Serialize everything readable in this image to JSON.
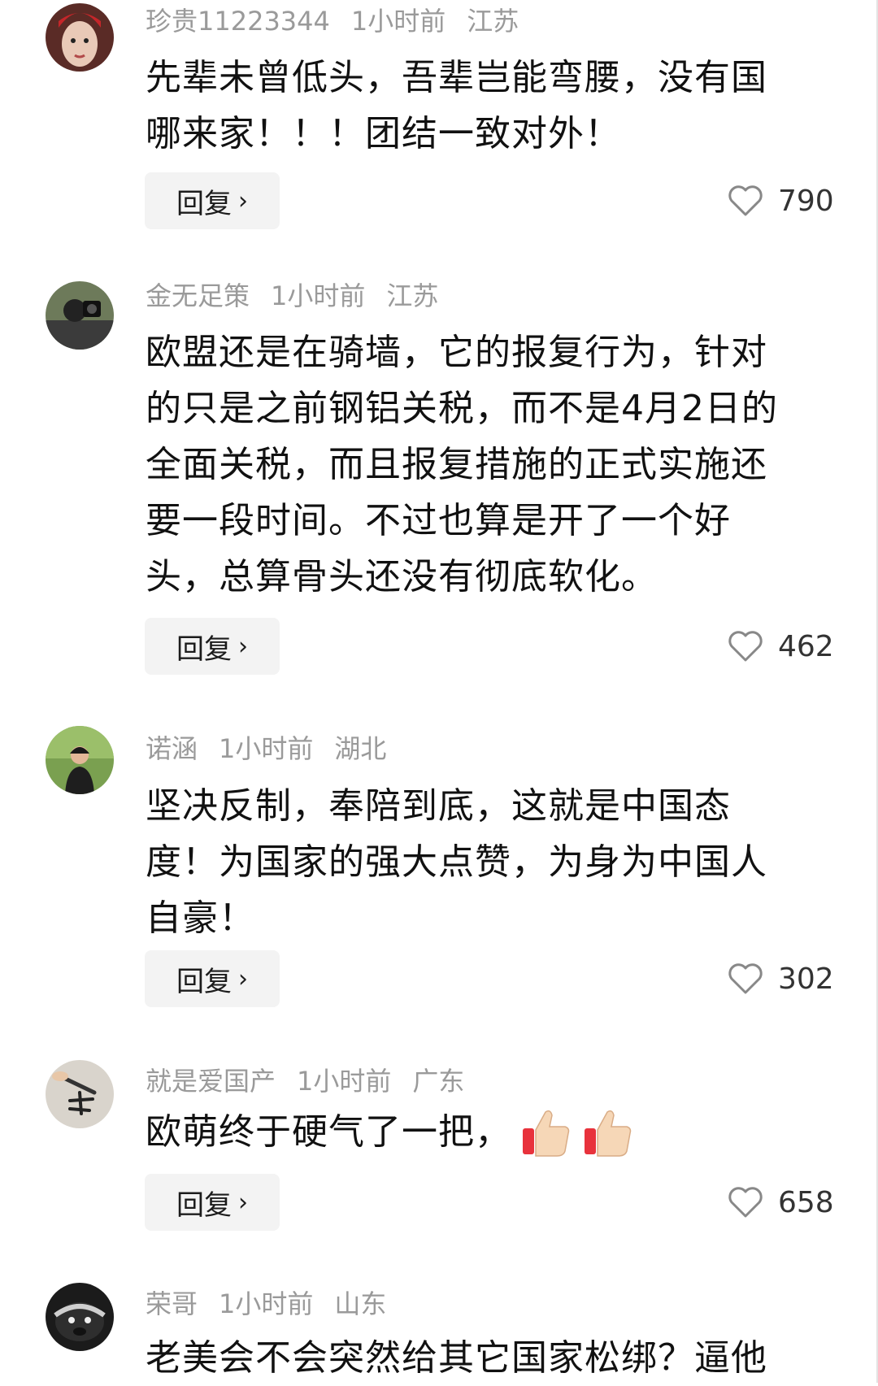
{
  "comments": [
    {
      "username": "珍贵11223344",
      "time": "1小时前",
      "location": "江苏",
      "lines": [
        "先辈未曾低头，吾辈岂能弯腰，没有国",
        "哪来家！！！团结一致对外！"
      ],
      "reply_label": "回复",
      "likes": "790"
    },
    {
      "username": "金无足策",
      "time": "1小时前",
      "location": "江苏",
      "lines": [
        "欧盟还是在骑墙，它的报复行为，针对",
        "的只是之前钢铝关税，而不是4月2日的",
        "全面关税，而且报复措施的正式实施还",
        "要一段时间。不过也算是开了一个好",
        "头，总算骨头还没有彻底软化。"
      ],
      "reply_label": "回复",
      "likes": "462"
    },
    {
      "username": "诺涵",
      "time": "1小时前",
      "location": "湖北",
      "lines": [
        "坚决反制，奉陪到底，这就是中国态",
        "度！为国家的强大点赞，为身为中国人",
        "自豪！"
      ],
      "reply_label": "回复",
      "likes": "302"
    },
    {
      "username": "就是爱国产",
      "time": "1小时前",
      "location": "广东",
      "lines": [
        "欧萌终于硬气了一把，"
      ],
      "emoji": [
        "thumbs-up-emoji",
        "thumbs-up-emoji"
      ],
      "reply_label": "回复",
      "likes": "658"
    },
    {
      "username": "荣哥",
      "time": "1小时前",
      "location": "山东",
      "lines": [
        "老美会不会突然给其它国家松绑？逼他"
      ]
    }
  ],
  "icons": {
    "reply_chevron": "chevron-right-icon",
    "like": "heart-outline-icon"
  },
  "colors": {
    "meta": "#9a9a9a",
    "text": "#111111",
    "reply_bg": "#f3f3f3"
  }
}
